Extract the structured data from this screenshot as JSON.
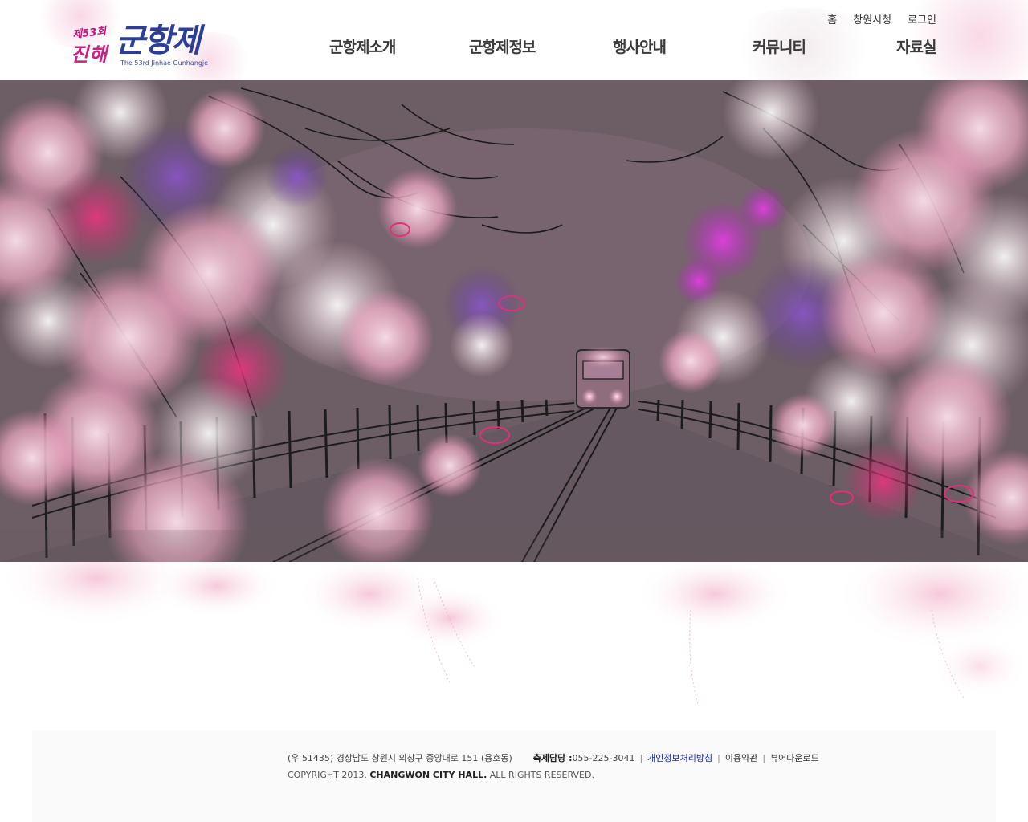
{
  "logo": {
    "ordinal": "제53회",
    "city": "진해",
    "title": "군항제",
    "subtitle": "The 53rd Jinhae Gunhangje"
  },
  "util_links": [
    {
      "label": "홈"
    },
    {
      "label": "창원시청"
    },
    {
      "label": "로그인"
    }
  ],
  "gnb": [
    {
      "label": "군항제소개"
    },
    {
      "label": "군항제정보"
    },
    {
      "label": "행사안내"
    },
    {
      "label": "커뮤니티"
    },
    {
      "label": "자료실"
    }
  ],
  "footer": {
    "address": "(우 51435) 경상남도 창원시 의창구 중앙대로 151 (용호동)",
    "contact_label": "축제담당 : ",
    "contact_phone": "055-225-3041",
    "privacy_link": "개인정보처리방침",
    "terms_link": "이용약관",
    "viewer_link": "뷰어다운로드",
    "copyright_prefix": "COPYRIGHT 2013. ",
    "copyright_org": "CHANGWON CITY HALL.",
    "copyright_suffix": " ALL RIGHTS RESERVED."
  },
  "colors": {
    "hero_bg": "#6c5c63",
    "blossom_pink": "#f2b6cc",
    "blossom_magenta": "#d43fd0",
    "blossom_purple": "#7a4bb0",
    "logo_blue": "#2b3f9a",
    "logo_pink": "#cc1f86",
    "privacy_link": "#1a2aa0"
  }
}
